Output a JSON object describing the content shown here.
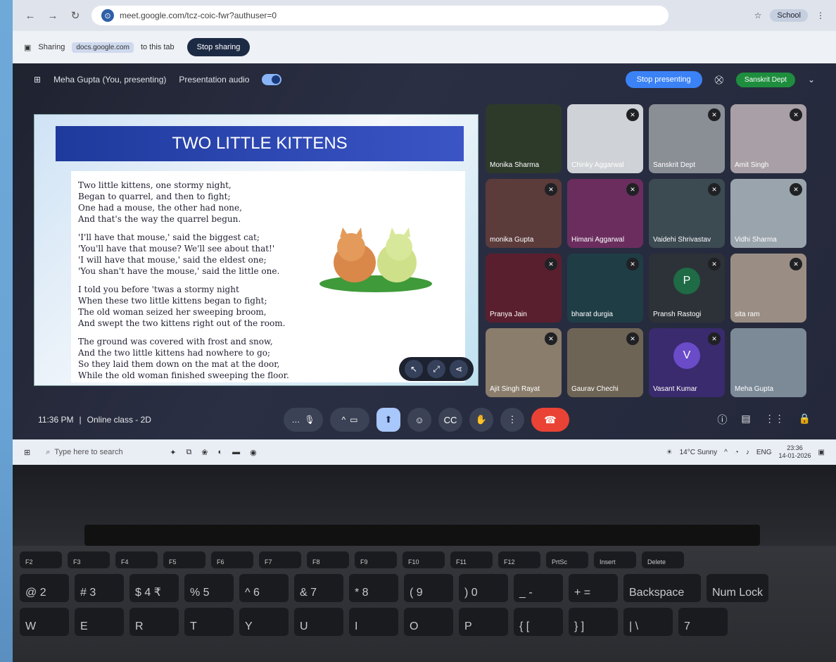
{
  "browser": {
    "url": "meet.google.com/tcz-coic-fwr?authuser=0",
    "profile_label": "School"
  },
  "share_bar": {
    "sharing_label": "Sharing",
    "shared_site": "docs.google.com",
    "to_tab": "to this tab",
    "stop_sharing": "Stop sharing"
  },
  "meet_header": {
    "presenter": "Meha Gupta (You, presenting)",
    "presentation_audio": "Presentation audio",
    "stop_presenting": "Stop presenting",
    "dept_label": "Sanskrit Dept"
  },
  "slide": {
    "title": "TWO LITTLE KITTENS",
    "stanzas": [
      [
        "Two little kittens, one stormy night,",
        "Began to quarrel, and then to fight;",
        "One had a mouse, the other had none,",
        "And that's the way the quarrel begun."
      ],
      [
        "'I'll have that mouse,' said the biggest cat;",
        "'You'll have that mouse? We'll see about that!'",
        "'I will have that mouse,' said the eldest one;",
        "'You shan't have the mouse,' said the little one."
      ],
      [
        "I told you before 'twas a stormy night",
        "When these two little kittens began to fight;",
        "The old woman seized her sweeping broom,",
        "And swept the two kittens right out of the room."
      ],
      [
        "The ground was covered with frost and snow,",
        "And the two little kittens had nowhere to go;",
        "So they laid them down on the mat at the door,",
        "While the old woman finished sweeping the floor."
      ]
    ]
  },
  "participants": [
    {
      "name": "Monika Sharma",
      "bg": "#2d3a2a"
    },
    {
      "name": "Chinky Aggarwal",
      "bg": "#cfd2d6"
    },
    {
      "name": "Sanskrit Dept",
      "bg": "#8a8f96"
    },
    {
      "name": "Amit Singh",
      "bg": "#a8a0a6"
    },
    {
      "name": "monika Gupta",
      "bg": "#5c3b3b"
    },
    {
      "name": "Himani Aggarwal",
      "bg": "#6b2d5e"
    },
    {
      "name": "Vaidehi Shrivastav",
      "bg": "#3c4a52"
    },
    {
      "name": "Vidhi Sharma",
      "bg": "#9aa4ac"
    },
    {
      "name": "Pranya Jain",
      "bg": "#5a1f2e"
    },
    {
      "name": "bharat durgia",
      "bg": "#1f3d45"
    },
    {
      "name": "Pransh Rastogi",
      "bg": "#2d3238",
      "letter": "P",
      "letter_bg": "#1e6b45"
    },
    {
      "name": "sita ram",
      "bg": "#9a8e84"
    },
    {
      "name": "Ajit Singh Rayat",
      "bg": "#8a7d6c"
    },
    {
      "name": "Gaurav Chechi",
      "bg": "#6e6455"
    },
    {
      "name": "Vasant Kumar",
      "bg": "#3a2a6e",
      "letter": "V",
      "letter_bg": "#6a4bc8"
    },
    {
      "name": "Meha Gupta",
      "bg": "#7c8a98"
    }
  ],
  "meet_footer": {
    "time": "11:36 PM",
    "separator": "|",
    "meeting_name": "Online class - 2D"
  },
  "taskbar": {
    "search_placeholder": "Type here to search",
    "weather": "14°C Sunny",
    "lang": "ENG",
    "clock_time": "23:36",
    "clock_date": "14-01-2026"
  },
  "keyboard": {
    "row1": [
      "",
      "F2",
      "F3",
      "F4",
      "F5",
      "F6",
      "F7",
      "F8",
      "F9",
      "F10",
      "F11",
      "F12",
      "PrtSc",
      "Insert",
      "Delete"
    ],
    "row2": [
      "@ 2",
      "# 3",
      "$ 4 ₹",
      "% 5",
      "^ 6",
      "& 7",
      "* 8",
      "( 9",
      ") 0",
      "_ -",
      "+ =",
      "Backspace",
      "Num Lock"
    ],
    "row3": [
      "W",
      "E",
      "R",
      "T",
      "Y",
      "U",
      "I",
      "O",
      "P",
      "{ [",
      "} ]",
      "| \\",
      "7"
    ]
  },
  "colors": {
    "accent": "#3b82f6",
    "end_call": "#ea4335",
    "dept_green": "#1e8e3e"
  }
}
